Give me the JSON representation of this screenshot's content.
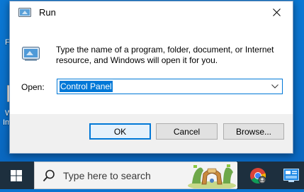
{
  "desktop": {
    "fragments": [
      "F",
      "W",
      "Im"
    ]
  },
  "dialog": {
    "title": "Run",
    "description": "Type the name of a program, folder, document, or Internet resource, and Windows will open it for you.",
    "open_label": "Open:",
    "open_value": "Control Panel",
    "ok_label": "OK",
    "cancel_label": "Cancel",
    "browse_label": "Browse..."
  },
  "taskbar": {
    "search_placeholder": "Type here to search"
  },
  "colors": {
    "accent": "#0078d7",
    "taskbar": "#1d2f3e",
    "desktop": "#0a74d0"
  }
}
